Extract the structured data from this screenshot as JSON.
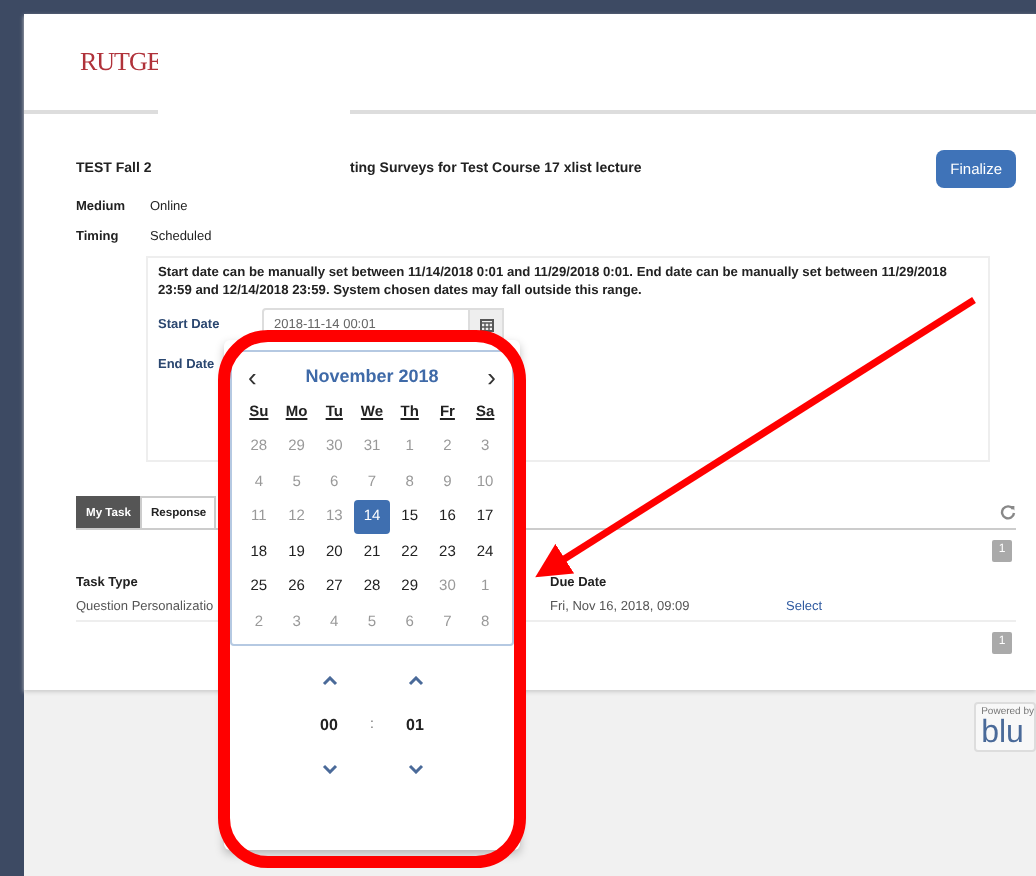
{
  "logo": {
    "text": "RUTGE"
  },
  "header": {
    "title_start": "TEST Fall 2",
    "title_end": "ting Surveys for Test Course 17 xlist lecture",
    "finalize_button": "Finalize"
  },
  "details": [
    {
      "label": "Medium",
      "value": "Online"
    },
    {
      "label": "Timing",
      "value": "Scheduled"
    }
  ],
  "date_range_note": "Start date can be manually set between 11/14/2018 0:01 and 11/29/2018 0:01. End date can be manually set between 11/29/2018 23:59 and 12/14/2018 23:59. System chosen dates may fall outside this range.",
  "start_date": {
    "label": "Start Date",
    "value": "2018-11-14 00:01"
  },
  "end_date": {
    "label": "End Date"
  },
  "tabs": [
    {
      "label": "My Task",
      "selected": true
    },
    {
      "label": "Response",
      "selected": false
    }
  ],
  "badges": [
    "1",
    "1"
  ],
  "table": {
    "columns": [
      "Task Type",
      "Due Date"
    ],
    "rows": [
      {
        "task_type": "Question Personalizatio",
        "due_date": "Fri, Nov 16, 2018, 09:09",
        "action": "Select"
      }
    ]
  },
  "footer": {
    "powered_by": "Powered by",
    "brand": "blu"
  },
  "date_picker": {
    "month": "November 2018",
    "prev": "‹",
    "next": "›",
    "weekdays": [
      "Su",
      "Mo",
      "Tu",
      "We",
      "Th",
      "Fr",
      "Sa"
    ],
    "weeks": [
      [
        {
          "day": "28",
          "disabled": true,
          "selected": false
        },
        {
          "day": "29",
          "disabled": true,
          "selected": false
        },
        {
          "day": "30",
          "disabled": true,
          "selected": false
        },
        {
          "day": "31",
          "disabled": true,
          "selected": false
        },
        {
          "day": "1",
          "disabled": true,
          "selected": false
        },
        {
          "day": "2",
          "disabled": true,
          "selected": false
        },
        {
          "day": "3",
          "disabled": true,
          "selected": false
        }
      ],
      [
        {
          "day": "4",
          "disabled": true,
          "selected": false
        },
        {
          "day": "5",
          "disabled": true,
          "selected": false
        },
        {
          "day": "6",
          "disabled": true,
          "selected": false
        },
        {
          "day": "7",
          "disabled": true,
          "selected": false
        },
        {
          "day": "8",
          "disabled": true,
          "selected": false
        },
        {
          "day": "9",
          "disabled": true,
          "selected": false
        },
        {
          "day": "10",
          "disabled": true,
          "selected": false
        }
      ],
      [
        {
          "day": "11",
          "disabled": true,
          "selected": false
        },
        {
          "day": "12",
          "disabled": true,
          "selected": false
        },
        {
          "day": "13",
          "disabled": true,
          "selected": false
        },
        {
          "day": "14",
          "disabled": false,
          "selected": true
        },
        {
          "day": "15",
          "disabled": false,
          "selected": false
        },
        {
          "day": "16",
          "disabled": false,
          "selected": false
        },
        {
          "day": "17",
          "disabled": false,
          "selected": false
        }
      ],
      [
        {
          "day": "18",
          "disabled": false,
          "selected": false
        },
        {
          "day": "19",
          "disabled": false,
          "selected": false
        },
        {
          "day": "20",
          "disabled": false,
          "selected": false
        },
        {
          "day": "21",
          "disabled": false,
          "selected": false
        },
        {
          "day": "22",
          "disabled": false,
          "selected": false
        },
        {
          "day": "23",
          "disabled": false,
          "selected": false
        },
        {
          "day": "24",
          "disabled": false,
          "selected": false
        }
      ],
      [
        {
          "day": "25",
          "disabled": false,
          "selected": false
        },
        {
          "day": "26",
          "disabled": false,
          "selected": false
        },
        {
          "day": "27",
          "disabled": false,
          "selected": false
        },
        {
          "day": "28",
          "disabled": false,
          "selected": false
        },
        {
          "day": "29",
          "disabled": false,
          "selected": false
        },
        {
          "day": "30",
          "disabled": true,
          "selected": false
        },
        {
          "day": "1",
          "disabled": true,
          "selected": false
        }
      ],
      [
        {
          "day": "2",
          "disabled": true,
          "selected": false
        },
        {
          "day": "3",
          "disabled": true,
          "selected": false
        },
        {
          "day": "4",
          "disabled": true,
          "selected": false
        },
        {
          "day": "5",
          "disabled": true,
          "selected": false
        },
        {
          "day": "6",
          "disabled": true,
          "selected": false
        },
        {
          "day": "7",
          "disabled": true,
          "selected": false
        },
        {
          "day": "8",
          "disabled": true,
          "selected": false
        }
      ]
    ],
    "time": {
      "hours": "00",
      "separator": ":",
      "minutes": "01"
    }
  }
}
